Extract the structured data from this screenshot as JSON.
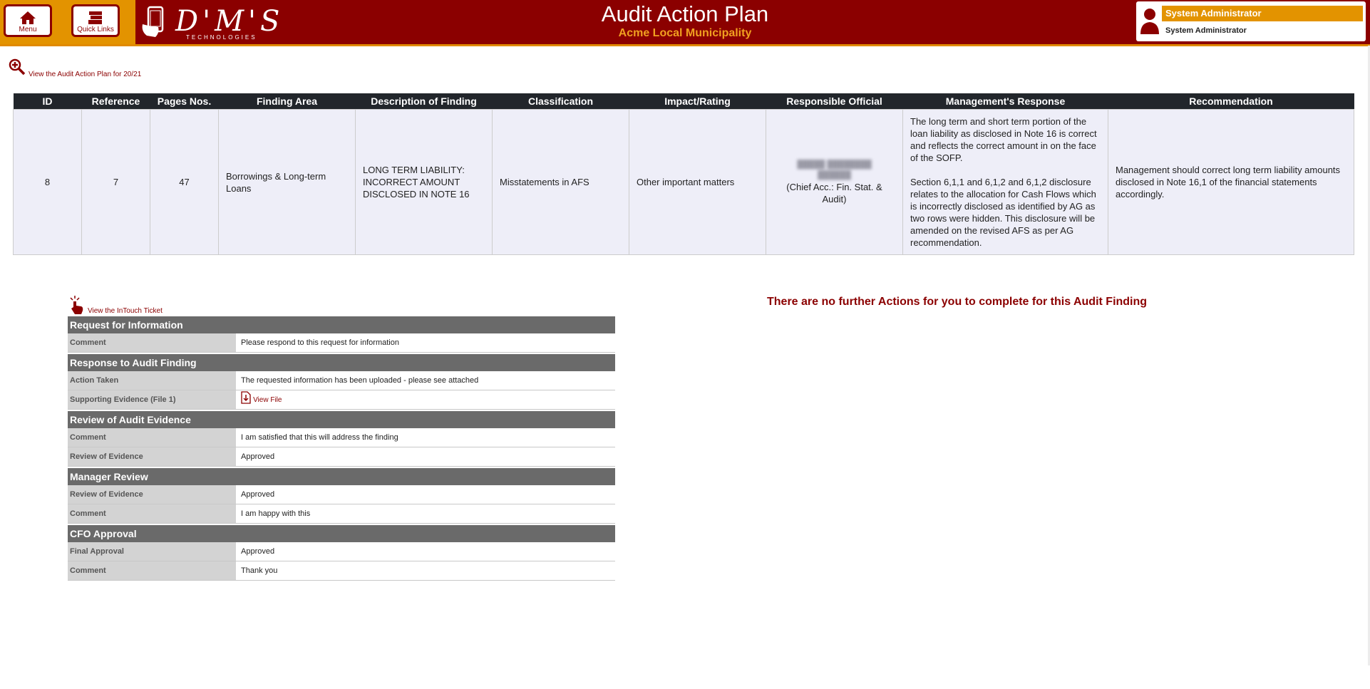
{
  "header": {
    "menu_label": "Menu",
    "quick_links_label": "Quick Links",
    "logo_text": "D'M'S",
    "logo_sub": "TECHNOLOGIES",
    "title": "Audit Action Plan",
    "subtitle": "Acme Local Municipality",
    "user_name": "System Administrator",
    "user_role": "System Administrator"
  },
  "view_plan_link": "View the Audit Action Plan for 20/21",
  "table": {
    "headers": [
      "ID",
      "Reference",
      "Pages Nos.",
      "Finding Area",
      "Description of Finding",
      "Classification",
      "Impact/Rating",
      "Responsible Official",
      "Management's Response",
      "Recommendation"
    ],
    "row": {
      "id": "8",
      "reference": "7",
      "pages": "47",
      "finding_area": "Borrowings & Long-term Loans",
      "description": "LONG TERM LIABILITY: INCORRECT AMOUNT DISCLOSED IN NOTE 16",
      "classification": "Misstatements in AFS",
      "impact": "Other important matters",
      "official_title": "(Chief Acc.: Fin. Stat. & Audit)",
      "response_p1": "The long term and short term portion of the loan liability as disclosed in Note 16 is correct and reflects the correct amount in on the face of the SOFP.",
      "response_p2": "Section 6,1,1 and 6,1,2 and 6,1,2 disclosure relates to the allocation for Cash Flows which is incorrectly disclosed as identified by AG as two rows were hidden.  This disclosure will be amended on the revised AFS as per AG recommendation.",
      "recommendation": "Management should correct long term liability amounts disclosed in Note 16,1 of the financial statements accordingly."
    }
  },
  "ticket_link": "View the InTouch Ticket",
  "sections": {
    "request": {
      "title": "Request for Information",
      "comment_label": "Comment",
      "comment_value": "Please respond to this request for information"
    },
    "response": {
      "title": "Response to Audit Finding",
      "action_label": "Action Taken",
      "action_value": "The requested information has been uploaded - please see attached",
      "evidence_label": "Supporting Evidence (File 1)",
      "evidence_link": "View File"
    },
    "review": {
      "title": "Review of Audit Evidence",
      "comment_label": "Comment",
      "comment_value": "I am satisfied that this will address the finding",
      "review_label": "Review of Evidence",
      "review_value": "Approved"
    },
    "manager": {
      "title": "Manager Review",
      "review_label": "Review of Evidence",
      "review_value": "Approved",
      "comment_label": "Comment",
      "comment_value": "I am happy with this"
    },
    "cfo": {
      "title": "CFO Approval",
      "final_label": "Final Approval",
      "final_value": "Approved",
      "comment_label": "Comment",
      "comment_value": "Thank you"
    }
  },
  "no_actions_message": "There are no further Actions for you to complete for this Audit Finding",
  "colors": {
    "brand": "#8b0000",
    "accent": "#e39300",
    "table_header": "#22262b",
    "section_header": "#6a6a6a"
  }
}
